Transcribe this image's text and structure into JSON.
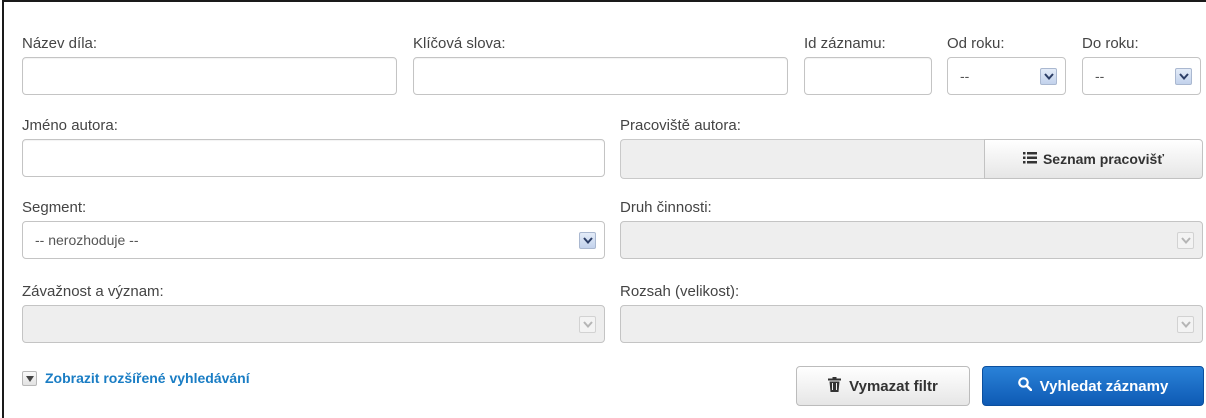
{
  "fields": {
    "nazev_dila": {
      "label": "Název díla:",
      "value": ""
    },
    "klicova_slova": {
      "label": "Klíčová slova:",
      "value": ""
    },
    "id_zaznamu": {
      "label": "Id záznamu:",
      "value": ""
    },
    "od_roku": {
      "label": "Od roku:",
      "value": "--"
    },
    "do_roku": {
      "label": "Do roku:",
      "value": "--"
    },
    "jmeno_autora": {
      "label": "Jméno autora:",
      "value": ""
    },
    "pracoviste_autora": {
      "label": "Pracoviště autora:",
      "value": ""
    },
    "segment": {
      "label": "Segment:",
      "value": "-- nerozhoduje --"
    },
    "druh_cinnosti": {
      "label": "Druh činnosti:",
      "value": ""
    },
    "zavaznost": {
      "label": "Závažnost a význam:",
      "value": ""
    },
    "rozsah": {
      "label": "Rozsah (velikost):",
      "value": ""
    }
  },
  "buttons": {
    "seznam_pracovist": "Seznam pracovišť",
    "vymazat_filtr": "Vymazat filtr",
    "vyhledat_zaznamy": "Vyhledat záznamy"
  },
  "advanced_toggle": "Zobrazit rozšířené vyhledávání",
  "colors": {
    "accent": "#1a7dc4",
    "primary_button": "#1565c0",
    "disabled_bg": "#eeeeee"
  },
  "icons": {
    "seznam_pracovist": "list-icon",
    "vymazat_filtr": "trash-icon",
    "vyhledat_zaznamy": "search-icon",
    "advanced_toggle": "caret-down-icon",
    "select_arrow": "chevron-down-icon"
  }
}
